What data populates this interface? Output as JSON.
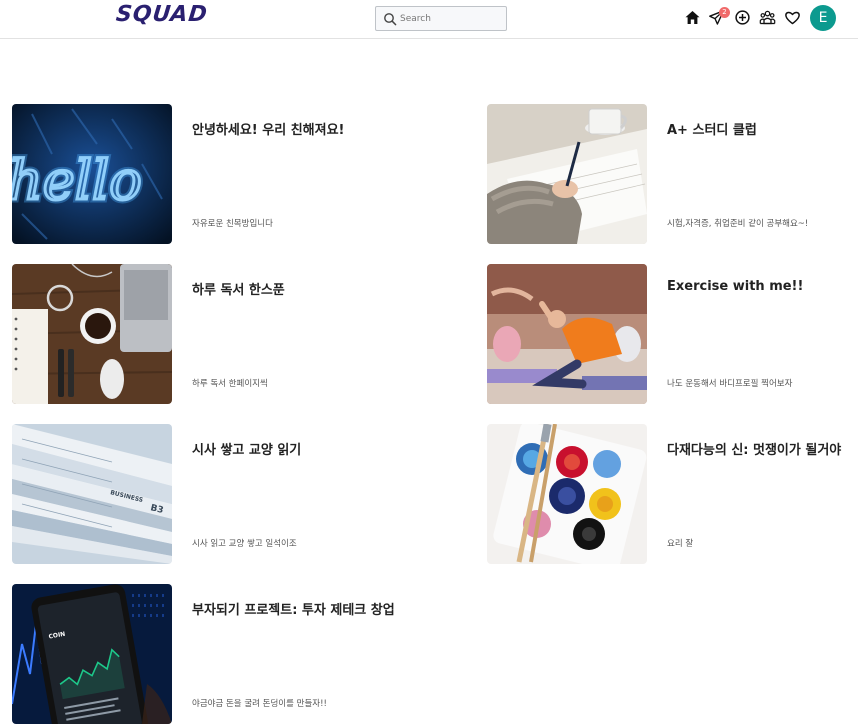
{
  "header": {
    "logo": "SQUAD",
    "search_placeholder": "Search",
    "notification_count": "2",
    "avatar_initial": "E"
  },
  "icons": {
    "home": "home-icon",
    "send": "paper-plane-icon",
    "create": "plus-circle-icon",
    "groups": "people-icon",
    "likes": "heart-icon",
    "search": "search-icon"
  },
  "colors": {
    "logo": "#2a2070",
    "avatar": "#0c9a8f",
    "badge": "#f06a6a"
  },
  "groups": [
    {
      "title": "안녕하세요! 우리 친해져요!",
      "description": "자유로운 친목방입니다",
      "image": "neon-hello-sign"
    },
    {
      "title": "A+ 스터디 클럽",
      "description": "시험,자격증, 취업준비 같이 공부해요~!",
      "image": "hand-writing-with-coffee"
    },
    {
      "title": "하루 독서 한스푼",
      "description": "하루 독서 한페이지씩",
      "image": "desk-with-coffee-and-laptop"
    },
    {
      "title": "Exercise with me!!",
      "description": "나도 운동해서 바디프로필 찍어보자",
      "image": "yoga-class-stretching"
    },
    {
      "title": "시사 쌓고 교양 읽기",
      "description": "시사 읽고 교양 쌓고 일석이조",
      "image": "stacked-newspapers"
    },
    {
      "title": "다재다능의 신: 멋쟁이가 될거야",
      "description": "요리 잘",
      "image": "paint-palette-with-brushes"
    },
    {
      "title": "부자되기 프로젝트: 투자 제테크 창업",
      "description": "야금야금 돈을 굴려 돈덩이를 만들자!!",
      "image": "phone-stock-chart"
    }
  ]
}
